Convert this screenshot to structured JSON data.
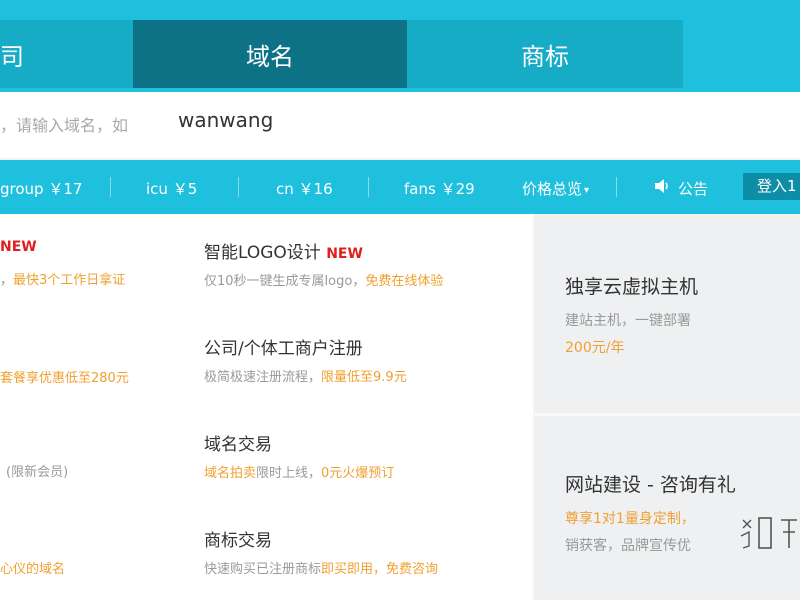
{
  "tabs": [
    {
      "label": "司"
    },
    {
      "label": "域名"
    },
    {
      "label": "商标"
    }
  ],
  "search": {
    "placeholder": "，请输入域名，如",
    "value": "wanwang"
  },
  "price_bar": {
    "items": [
      {
        "label": "group ￥17"
      },
      {
        "label": "icu ￥5"
      },
      {
        "label": "cn ￥16"
      },
      {
        "label": "fans ￥29"
      }
    ],
    "price_details_label": "价格总览",
    "notice_label": "公告",
    "login_label": "登入1"
  },
  "left_column": {
    "badge": "NEW",
    "frag1_gray": "，",
    "frag1_orange": "最快3个工作日拿证",
    "frag2_orange": "套餐享优惠低至280元",
    "frag3_gray": "(限新会员)",
    "frag4_orange": "心仪的域名"
  },
  "services": [
    {
      "title": "智能LOGO设计",
      "badge": "NEW",
      "desc_gray": "仅10秒一键生成专属logo，",
      "desc_orange": "免费在线体验"
    },
    {
      "title": "公司/个体工商户注册",
      "desc_gray": "极简极速注册流程，",
      "desc_orange": "限量低至9.9元"
    },
    {
      "title": "域名交易",
      "desc_orange": "域名拍卖",
      "desc_gray": "限时上线，",
      "desc_orange2": "0元火爆预订"
    },
    {
      "title": "商标交易",
      "desc_gray": "快速购买已注册商标",
      "desc_orange": "即买即用，",
      "desc_orange2": "免费咨询"
    }
  ],
  "cards": [
    {
      "title": "独享云虚拟主机",
      "desc": "建站主机，一键部署",
      "price": "200元/年"
    },
    {
      "title": "网站建设 - 咨询有礼",
      "desc_orange": "尊享1对1量身定制，",
      "desc": "销获客，品牌宣传优"
    }
  ],
  "colors": {
    "brand_cyan": "#1fc0dd",
    "active_tab": "#0d7286",
    "orange": "#f0a030",
    "new_red": "#e02020"
  },
  "icons": [
    "speaker-icon",
    "caret-down-icon",
    "floating-contact-icon"
  ]
}
